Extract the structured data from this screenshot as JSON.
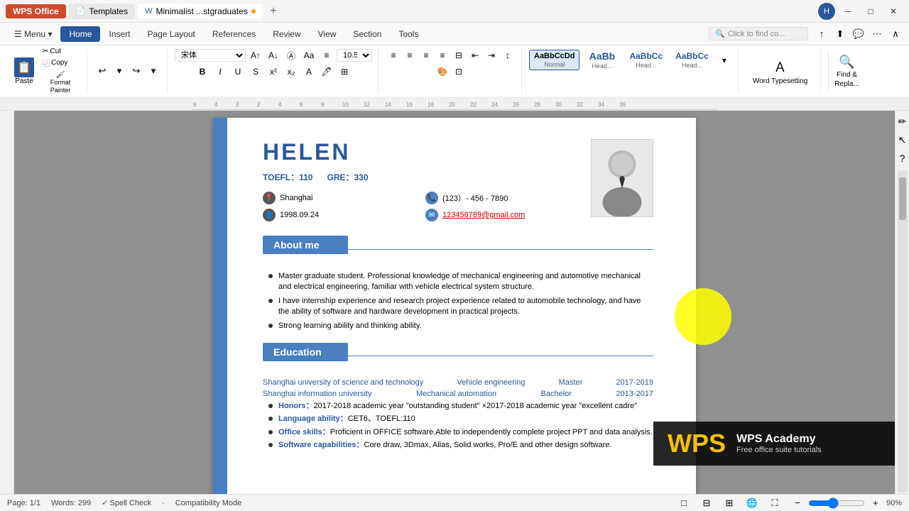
{
  "titlebar": {
    "wps_label": "WPS Office",
    "templates_label": "Templates",
    "doc_tab_label": "Minimalist ...stgraduates",
    "add_tab_label": "+"
  },
  "ribbon": {
    "tabs": [
      "Menu",
      "Home",
      "Insert",
      "Page Layout",
      "References",
      "Review",
      "View",
      "Section",
      "Tools"
    ],
    "active_tab": "Home",
    "search_placeholder": "Click to find co...",
    "toolbar": {
      "paste_label": "Paste",
      "cut_label": "Cut",
      "copy_label": "Copy",
      "format_painter_label": "Format Painter",
      "font_name": "宋体",
      "font_size": "10.5",
      "bold_label": "B",
      "italic_label": "I",
      "underline_label": "U",
      "styles": [
        {
          "label": "Normal",
          "preview": "AaBbCcDd"
        },
        {
          "label": "Head...",
          "preview": "AaBb"
        },
        {
          "label": "Head...",
          "preview": "AaBbCc"
        },
        {
          "label": "Head...",
          "preview": "AaBbCc"
        }
      ],
      "word_typesetting_label": "Word Typesetting",
      "find_label": "Find &",
      "replace_label": "Repla..."
    }
  },
  "document": {
    "resume": {
      "name": "HELEN",
      "toefl_label": "TOEFL：110",
      "gre_label": "GRE：330",
      "location": "Shanghai",
      "phone": "(123）- 456 - 7890",
      "birthdate": "1998.09.24",
      "email": "123456789@gmail.com",
      "about_me_header": "About me",
      "about_bullets": [
        "Master graduate student. Professional knowledge of mechanical engineering and automotive mechanical and electrical engineering, familiar with vehicle electrical system structure.",
        "I have internship experience and research project experience related to automobile technology, and have the ability of software and hardware development in practical projects.",
        "Strong learning ability and thinking ability."
      ],
      "education_header": "Education",
      "edu_rows": [
        {
          "school": "Shanghai university of science and technology",
          "major": "Vehicle engineering",
          "degree": "Master",
          "years": "2017-2019"
        },
        {
          "school": "Shanghai information university",
          "major": "Mechanical automation",
          "degree": "Bachelor",
          "years": "2013-2017"
        }
      ],
      "honors_items": [
        {
          "label": "Honors：",
          "text": "2017-2018 academic year \"outstanding student\" ×2017-2018 academic year \"excellent cadre\""
        },
        {
          "label": "Language ability：",
          "text": "CET6、TOEFL:110"
        },
        {
          "label": "Office skills：",
          "text": "Proficient in OFFICE software.Able to independently complete project PPT and data analysis."
        },
        {
          "label": "Software capabilities：",
          "text": "Core draw, 3Dmax, Alias, Solid works, Pro/E and other design software."
        }
      ]
    }
  },
  "status_bar": {
    "page_info": "Page: 1/1",
    "words": "Words: 299",
    "spell_check": "Spell Check",
    "compatibility": "Compatibility Mode",
    "zoom": "90%"
  },
  "wps_academy": {
    "logo_text": "WPS",
    "title": "WPS Academy",
    "subtitle": "Free office suite tutorials"
  }
}
